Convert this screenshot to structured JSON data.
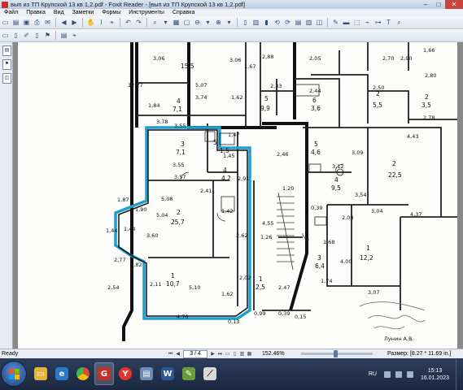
{
  "window": {
    "title": "вып из ТП Крупской 13 кв 1,2.pdf - Foxit Reader - [вып из ТП Крупской 13 кв 1,2.pdf]",
    "minimize": "–",
    "maximize": "□",
    "close": "✕"
  },
  "menu": [
    "Файл",
    "Правка",
    "Вид",
    "Заметки",
    "Формы",
    "Инструменты",
    "Справка"
  ],
  "toolbar": {
    "zoom_value": "",
    "page_value": ""
  },
  "plan": {
    "rooms": [
      {
        "num": "1",
        "area": "15,5"
      },
      {
        "num": "4",
        "area": "7,1"
      },
      {
        "num": "5",
        "area": "9,9"
      },
      {
        "num": "6",
        "area": "3,6"
      },
      {
        "num": "2",
        "area": "5,5"
      },
      {
        "num": "2",
        "area": "3,5"
      },
      {
        "num": "3",
        "area": "7,1"
      },
      {
        "num": "4",
        "area": "4,2"
      },
      {
        "num": "5",
        "area": "1,5"
      },
      {
        "num": "6",
        "area": "1,42"
      },
      {
        "num": "2",
        "area": "25,7"
      },
      {
        "num": "1",
        "area": "10,7"
      },
      {
        "num": "5",
        "area": "4,6"
      },
      {
        "num": "4",
        "area": "9,5"
      },
      {
        "num": "2",
        "area": "22,5"
      },
      {
        "num": "3",
        "area": "6,4"
      },
      {
        "num": "1",
        "area": "12,2"
      },
      {
        "num": "1",
        "area": "2,5"
      }
    ],
    "dims": [
      "3,06",
      "3,06",
      "2,88",
      "2,05",
      "1,66",
      "2,70",
      "2,90",
      "5,07",
      "3,74",
      "1,62",
      "12,27",
      "1,84",
      "2,33",
      "2,44",
      "2,50",
      "2,78",
      "2,80",
      "1,67",
      "1,45",
      "2,46",
      "3,55",
      "3,57",
      "3,55",
      "5,08",
      "5,04",
      "3,60",
      "2,62",
      "1,44",
      "1,87",
      "1,90",
      "1,82",
      "1,44",
      "2,77",
      "2,54",
      "2,11",
      "2,02",
      "4,76",
      "5,10",
      "1,62",
      "0,13",
      "0,15",
      "0,99",
      "0,39",
      "3,12",
      "4,43",
      "3,09",
      "3,54",
      "2,08",
      "3,04",
      "4,37",
      "1,68",
      "1,74",
      "2,47",
      "4,00",
      "3,07",
      "4,55",
      "1,26",
      "1,20",
      "0,39",
      "3,78",
      "1,47",
      "2,91",
      "2,41"
    ],
    "stamp_text": "Лунин А.В."
  },
  "status": {
    "ready": "Ready",
    "page": "3 / 4",
    "zoom": "152.46%",
    "size": "Размер: [8.27 * 11.69 in.]"
  },
  "taskbar": {
    "apps": [
      {
        "name": "explorer",
        "icon": "folder-icon",
        "color": "#e5b43c"
      },
      {
        "name": "ie",
        "icon": "internet-explorer-icon",
        "color": "#2a79c9"
      },
      {
        "name": "chrome",
        "icon": "chrome-icon",
        "color": "#dd4b39"
      },
      {
        "name": "foxit",
        "icon": "foxit-reader-icon",
        "color": "#c4302b"
      },
      {
        "name": "yandex",
        "icon": "yandex-browser-icon",
        "color": "#e8322a"
      },
      {
        "name": "files",
        "icon": "file-manager-icon",
        "color": "#6b8bb5"
      },
      {
        "name": "word",
        "icon": "word-icon",
        "color": "#2b5797"
      },
      {
        "name": "paint",
        "icon": "paint-icon",
        "color": "#6a9c3b"
      },
      {
        "name": "tool",
        "icon": "tool-icon",
        "color": "#d9d9d9"
      }
    ],
    "lang": "RU",
    "time": "15:13",
    "date": "16.01.2023"
  }
}
